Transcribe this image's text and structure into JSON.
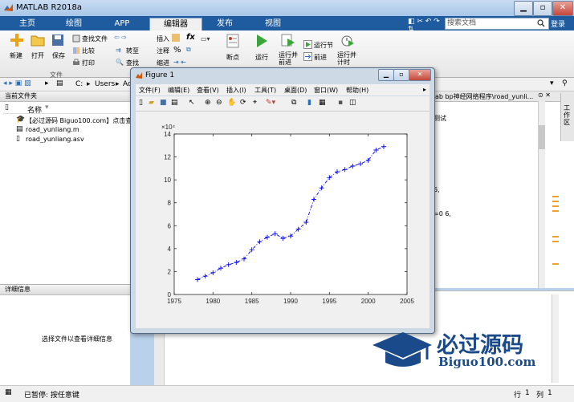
{
  "window": {
    "title": "MATLAB R2018a"
  },
  "tabs": [
    {
      "label": "主页"
    },
    {
      "label": "绘图"
    },
    {
      "label": "APP"
    },
    {
      "label": "编辑器"
    },
    {
      "label": "发布"
    },
    {
      "label": "视图"
    }
  ],
  "search": {
    "placeholder": "搜索文档"
  },
  "login_label": "登录",
  "ribbon": {
    "new_label": "新建",
    "open_label": "打开",
    "save_label": "保存",
    "find_files_label": "查找文件",
    "compare_label": "比较",
    "print_label": "打印",
    "goto_label": "转至",
    "find_label": "查找",
    "insert_label": "插入",
    "comment_label": "注释",
    "indent_label": "缩进",
    "fx_label": "fx",
    "pct_label": "%",
    "breakpoint_label": "断点",
    "run_label": "运行",
    "run_advance_label": "运行并\n前进",
    "run_section_label": "运行节",
    "advance_label": "前进",
    "run_time_label": "运行并\n计时",
    "group_file": "文件"
  },
  "address": {
    "path": [
      "C:",
      "Users",
      "Ad"
    ]
  },
  "current_folder": {
    "header": "当前文件夹",
    "column": "名称",
    "files": [
      {
        "name": "【必过源码 Biguo100.com】点击查"
      },
      {
        "name": "road_yunliang.m"
      },
      {
        "name": "road_yunliang.asv"
      }
    ]
  },
  "details": {
    "header": "详细信息",
    "placeholder": "选择文件以查看详细信息"
  },
  "editor": {
    "tab_text": "ab bp神经网络程序\\road_yunli...",
    "side_label": "工作区",
    "code_lines": [
      "测试",
      "6,",
      "=0 6,"
    ]
  },
  "status": {
    "text": "已暂停: 按任意键",
    "row_label": "行",
    "row_value": "1",
    "col_label": "列",
    "col_value": "1"
  },
  "figure": {
    "title": "Figure 1",
    "menus": [
      "文件(F)",
      "编辑(E)",
      "查看(V)",
      "插入(I)",
      "工具(T)",
      "桌面(D)",
      "窗口(W)",
      "帮助(H)"
    ]
  },
  "chart_data": {
    "type": "line",
    "title": "",
    "xlabel": "",
    "ylabel": "",
    "exponent_label": "×10⁴",
    "xlim": [
      1975,
      2005
    ],
    "ylim": [
      0,
      14
    ],
    "xticks": [
      1975,
      1980,
      1985,
      1990,
      1995,
      2000,
      2005
    ],
    "yticks": [
      0,
      2,
      4,
      6,
      8,
      10,
      12,
      14
    ],
    "grid": false,
    "line_style": "dash-dot with + markers",
    "color": "#0000ff",
    "x": [
      1978,
      1979,
      1980,
      1981,
      1982,
      1983,
      1984,
      1985,
      1986,
      1987,
      1988,
      1989,
      1990,
      1991,
      1992,
      1993,
      1994,
      1995,
      1996,
      1997,
      1998,
      1999,
      2000,
      2001,
      2002
    ],
    "y": [
      1.3,
      1.6,
      1.9,
      2.3,
      2.6,
      2.8,
      3.1,
      3.9,
      4.6,
      5.0,
      5.3,
      4.9,
      5.1,
      5.7,
      6.3,
      8.3,
      9.3,
      10.2,
      10.7,
      10.9,
      11.2,
      11.4,
      11.7,
      12.6,
      12.9
    ]
  },
  "watermark": {
    "cn": "必过源码",
    "en": "Biguo100.com"
  },
  "colors": {
    "accent": "#1f5c9f",
    "series": "#0000ff",
    "watermark": "#1a4a8a"
  }
}
